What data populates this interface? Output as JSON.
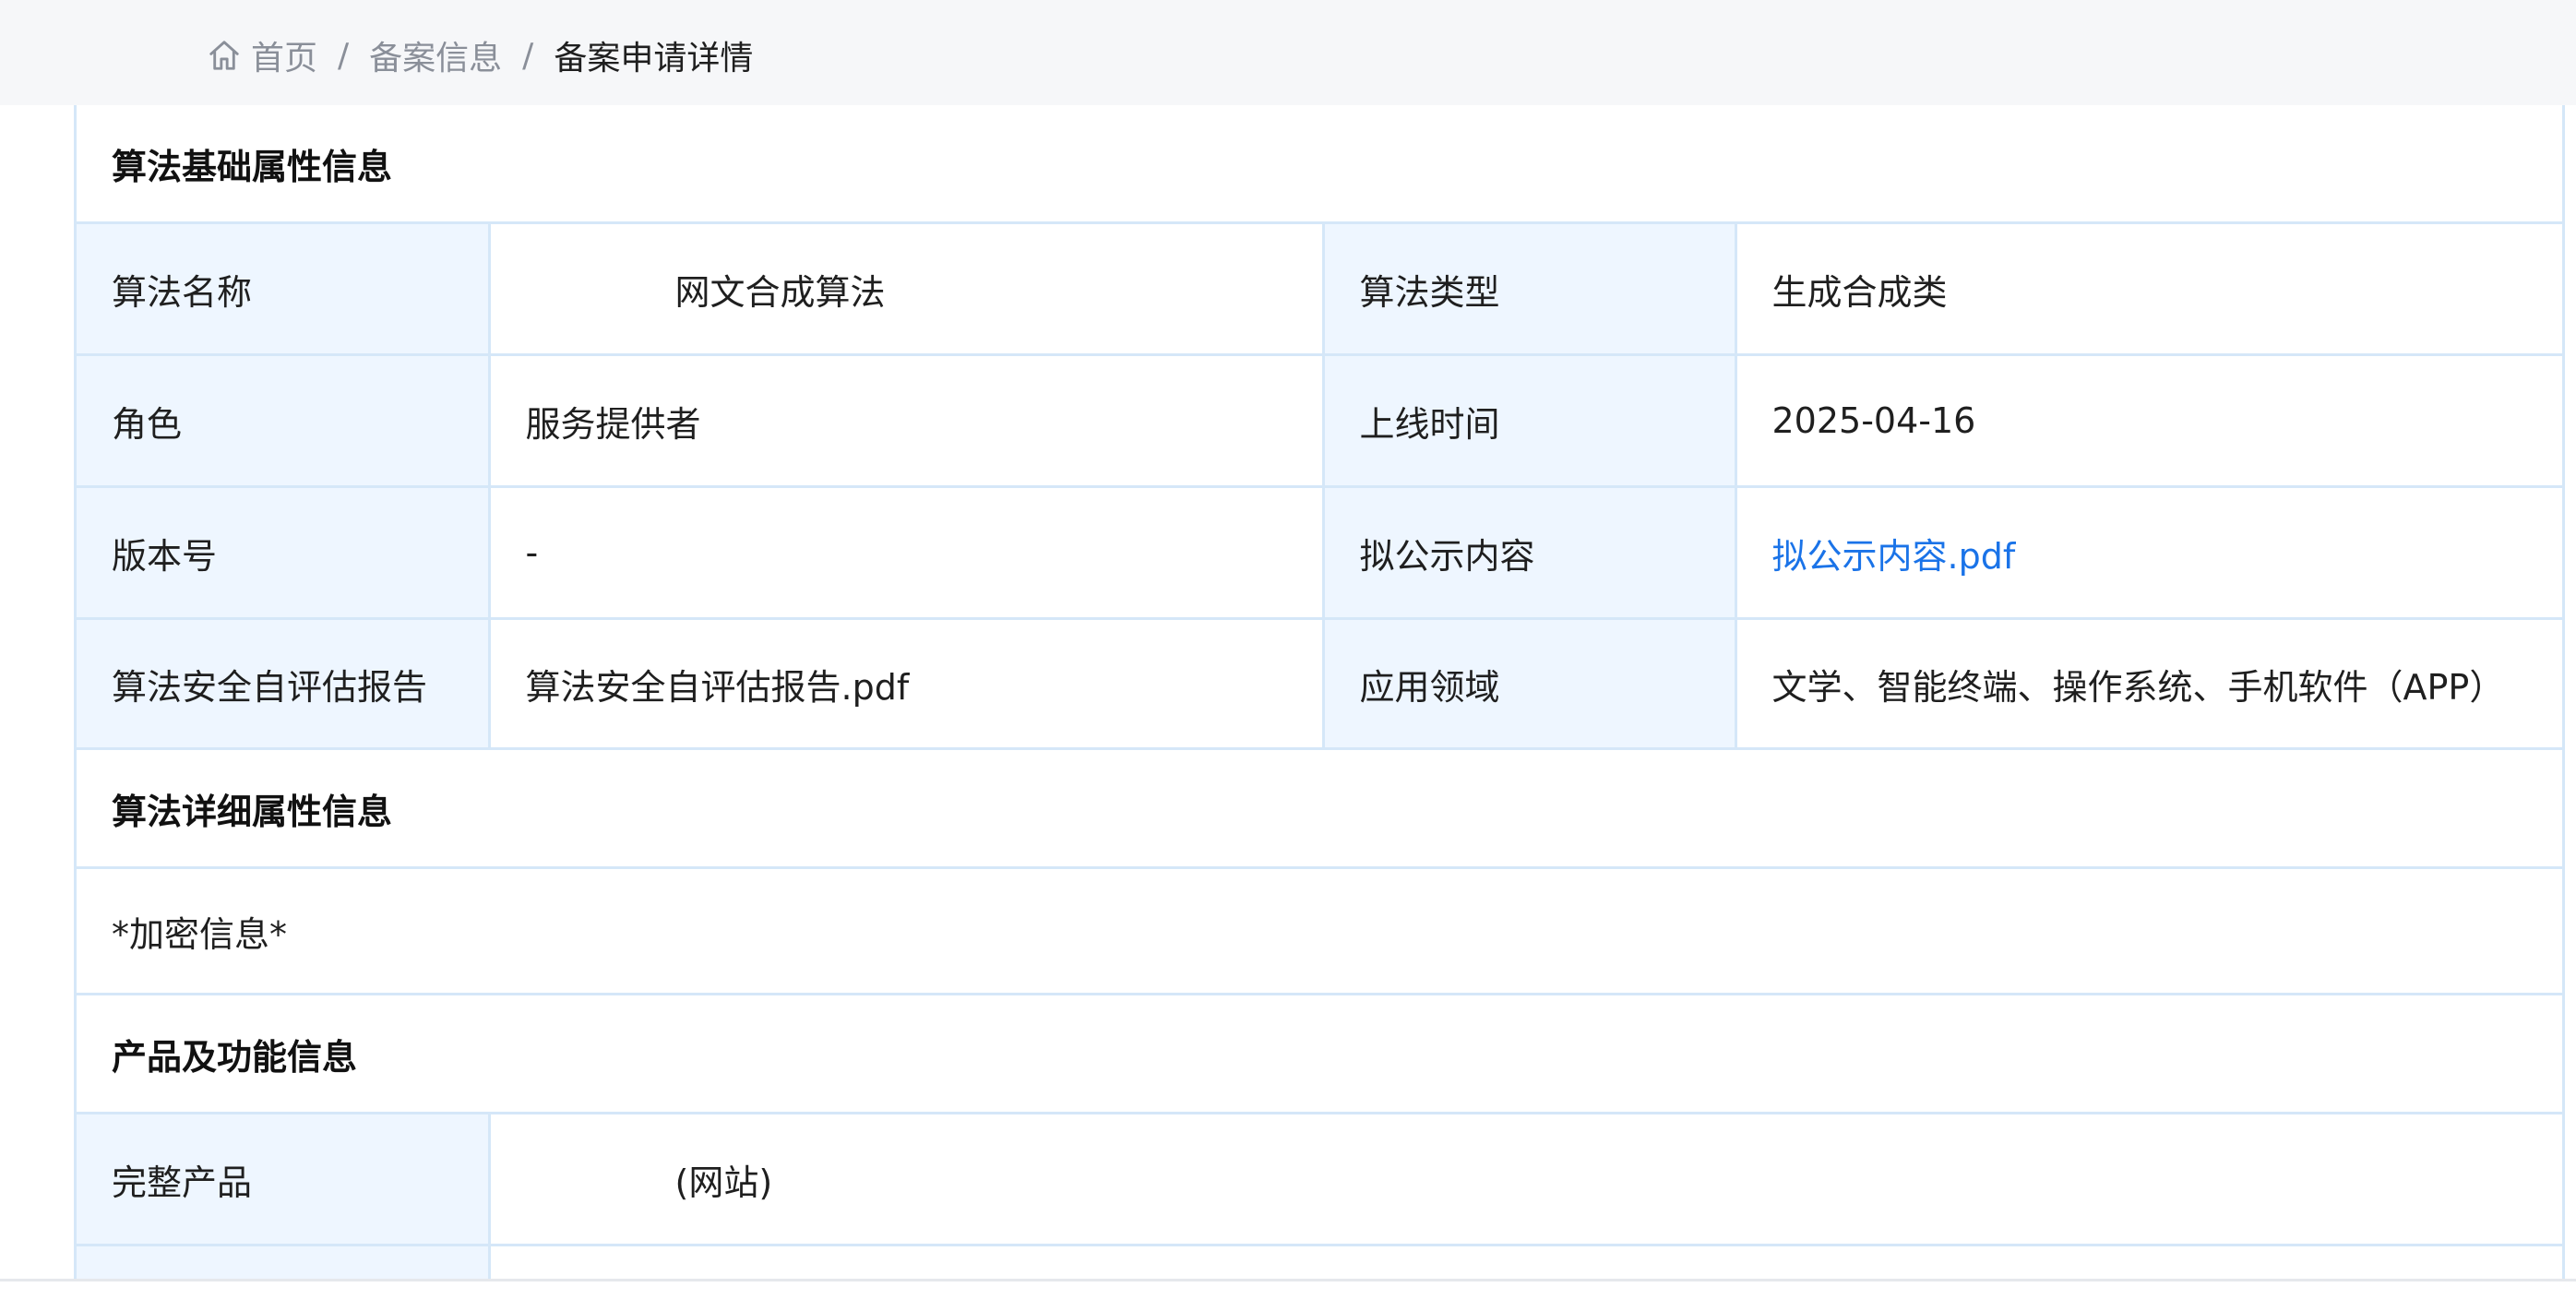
{
  "breadcrumb": {
    "home": "首页",
    "separator": "/",
    "level2": "备案信息",
    "current": "备案申请详情"
  },
  "sections": {
    "basic_title": "算法基础属性信息",
    "detail_title": "算法详细属性信息",
    "encrypted": "*加密信息*",
    "product_title": "产品及功能信息"
  },
  "basic": {
    "name_label": "算法名称",
    "name_value": "网文合成算法",
    "type_label": "算法类型",
    "type_value": "生成合成类",
    "role_label": "角色",
    "role_value": "服务提供者",
    "online_label": "上线时间",
    "online_value": "2025-04-16",
    "version_label": "版本号",
    "version_value": "-",
    "public_label": "拟公示内容",
    "public_value": "拟公示内容.pdf",
    "report_label": "算法安全自评估报告",
    "report_value": "算法安全自评估报告.pdf",
    "field_label": "应用领域",
    "field_value": "文学、智能终端、操作系统、手机软件（APP）"
  },
  "product": {
    "full_label": "完整产品",
    "full_value": "(网站)"
  },
  "colors": {
    "border": "#d5e7f8",
    "label_bg": "#eef6ff",
    "link": "#1a73e8",
    "topbar": "#f6f7f9"
  }
}
